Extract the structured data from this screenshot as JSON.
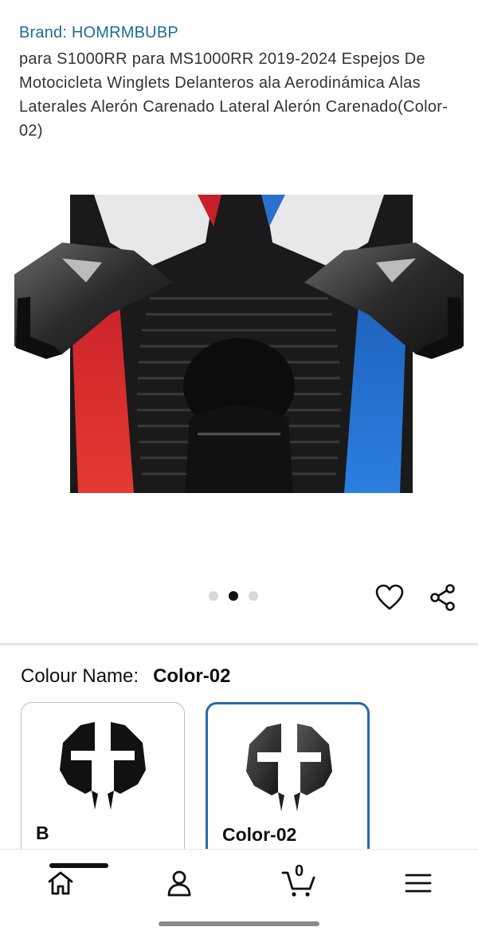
{
  "product": {
    "brand": "Brand: HOMRMBUBP",
    "title": "para S1000RR para MS1000RR 2019-2024 Espejos De Motocicleta Winglets Delanteros ala Aerodinámica Alas Laterales Alerón Carenado Lateral Alerón Carenado(Color-02)"
  },
  "gallery": {
    "image_icon": "motorcycle-front-winglets-photo",
    "dots_total": 3,
    "active_dot": 2
  },
  "actions": {
    "wishlist_icon": "heart-icon",
    "share_icon": "share-icon"
  },
  "variation": {
    "label": "Colour Name:",
    "selected_value": "Color-02",
    "options": [
      {
        "label": "B",
        "selected": false
      },
      {
        "label": "Color-02",
        "selected": true
      }
    ]
  },
  "nav": {
    "items": [
      {
        "name": "home",
        "icon": "home-icon",
        "active": true
      },
      {
        "name": "account",
        "icon": "person-icon"
      },
      {
        "name": "cart",
        "icon": "cart-icon",
        "count": "0"
      },
      {
        "name": "menu",
        "icon": "hamburger-menu-icon"
      }
    ]
  },
  "colors": {
    "link": "#1a6e9c",
    "selected_border": "#2a6aa6",
    "text": "#0f1111"
  }
}
